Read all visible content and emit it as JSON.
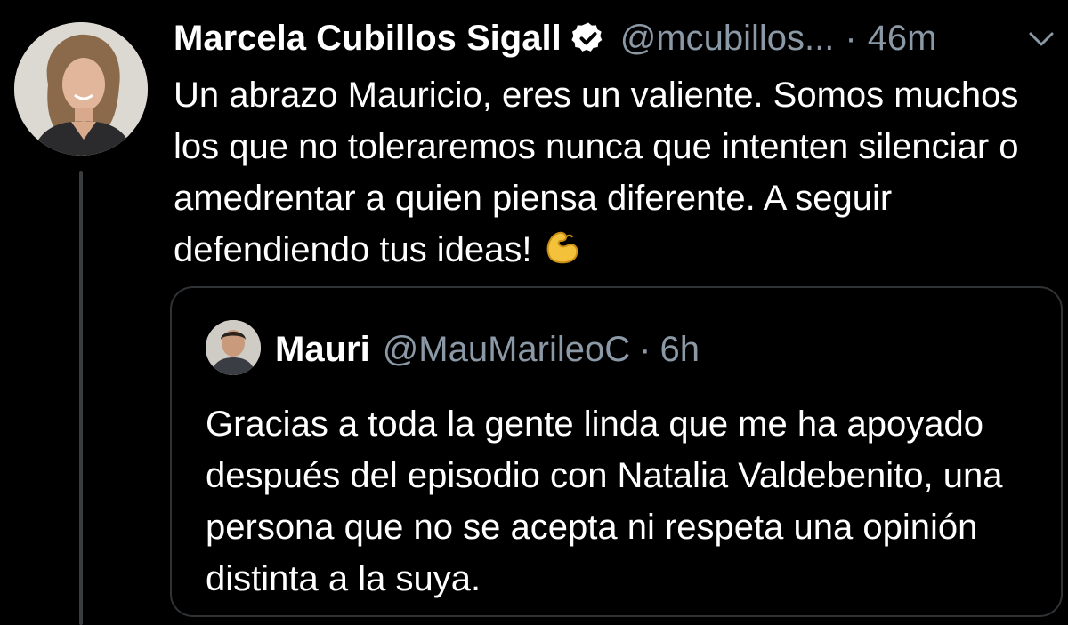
{
  "tweet": {
    "author": {
      "display_name": "Marcela Cubillos Sigall",
      "handle": "@mcubillos...",
      "verified_icon": "verified-badge-icon",
      "avatar_icon": "profile-photo"
    },
    "separator": "·",
    "time": "46m",
    "menu_icon": "chevron-down-icon",
    "text": "Un abrazo Mauricio, eres un valiente. Somos muchos los que no toleraremos nunca que intenten silenciar o amedrentar a quien piensa diferente. A seguir defendiendo tus ideas!",
    "emoji": "flexed-biceps-icon"
  },
  "quoted_tweet": {
    "author": {
      "display_name": "Mauri",
      "handle": "@MauMarileoC",
      "avatar_icon": "profile-photo"
    },
    "separator": "·",
    "time": "6h",
    "text": "Gracias a toda la gente linda que me ha apoyado después del episodio con Natalia Valdebenito, una persona que no se acepta ni respeta una opinión distinta a la suya."
  },
  "colors": {
    "background": "#000000",
    "primary_text": "#ffffff",
    "secondary_text": "#8b98a5",
    "border": "#2f3336",
    "thread_line": "#3a3d40"
  }
}
